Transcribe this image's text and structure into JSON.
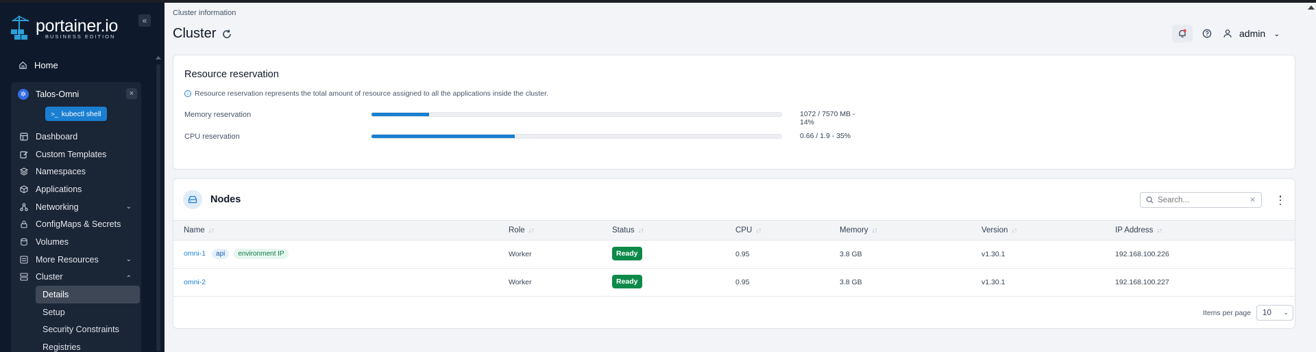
{
  "brand": {
    "name": "portainer.io",
    "edition": "BUSINESS EDITION"
  },
  "sidebar": {
    "collapse_icon": "«",
    "home": "Home",
    "environment": {
      "name": "Talos-Omni",
      "close": "×",
      "kubectl": "kubectl shell"
    },
    "items": [
      {
        "label": "Dashboard",
        "icon": "dashboard-icon"
      },
      {
        "label": "Custom Templates",
        "icon": "edit-icon"
      },
      {
        "label": "Namespaces",
        "icon": "layers-icon"
      },
      {
        "label": "Applications",
        "icon": "box-icon"
      },
      {
        "label": "Networking",
        "icon": "network-icon",
        "expandable": true
      },
      {
        "label": "ConfigMaps & Secrets",
        "icon": "lock-icon"
      },
      {
        "label": "Volumes",
        "icon": "database-icon"
      },
      {
        "label": "More Resources",
        "icon": "list-icon",
        "expandable": true
      },
      {
        "label": "Cluster",
        "icon": "server-icon",
        "expanded": true
      }
    ],
    "cluster_sub": [
      {
        "label": "Details",
        "active": true
      },
      {
        "label": "Setup"
      },
      {
        "label": "Security Constraints"
      },
      {
        "label": "Registries"
      }
    ]
  },
  "header": {
    "breadcrumb": "Cluster information",
    "title": "Cluster",
    "user": "admin"
  },
  "resource_reservation": {
    "title": "Resource reservation",
    "info": "Resource reservation represents the total amount of resource assigned to all the applications inside the cluster.",
    "memory": {
      "label": "Memory reservation",
      "value_text": "1072 / 7570 MB - 14%",
      "percent": 14
    },
    "cpu": {
      "label": "CPU reservation",
      "value_text": "0.66 / 1.9 - 35%",
      "percent": 35
    }
  },
  "nodes": {
    "title": "Nodes",
    "search_placeholder": "Search...",
    "columns": [
      "Name",
      "Role",
      "Status",
      "CPU",
      "Memory",
      "Version",
      "IP Address"
    ],
    "rows": [
      {
        "name": "omni-1",
        "tags": [
          "api",
          "environment IP"
        ],
        "role": "Worker",
        "status": "Ready",
        "cpu": "0.95",
        "memory": "3.8 GB",
        "version": "v1.30.1",
        "ip": "192.168.100.226"
      },
      {
        "name": "omni-2",
        "tags": [],
        "role": "Worker",
        "status": "Ready",
        "cpu": "0.95",
        "memory": "3.8 GB",
        "version": "v1.30.1",
        "ip": "192.168.100.227"
      }
    ],
    "items_per_page_label": "Items per page",
    "items_per_page": "10"
  },
  "colors": {
    "accent": "#1a7fd1",
    "sidebar_bg": "#0e1a2b",
    "ready": "#0d8a4a"
  }
}
